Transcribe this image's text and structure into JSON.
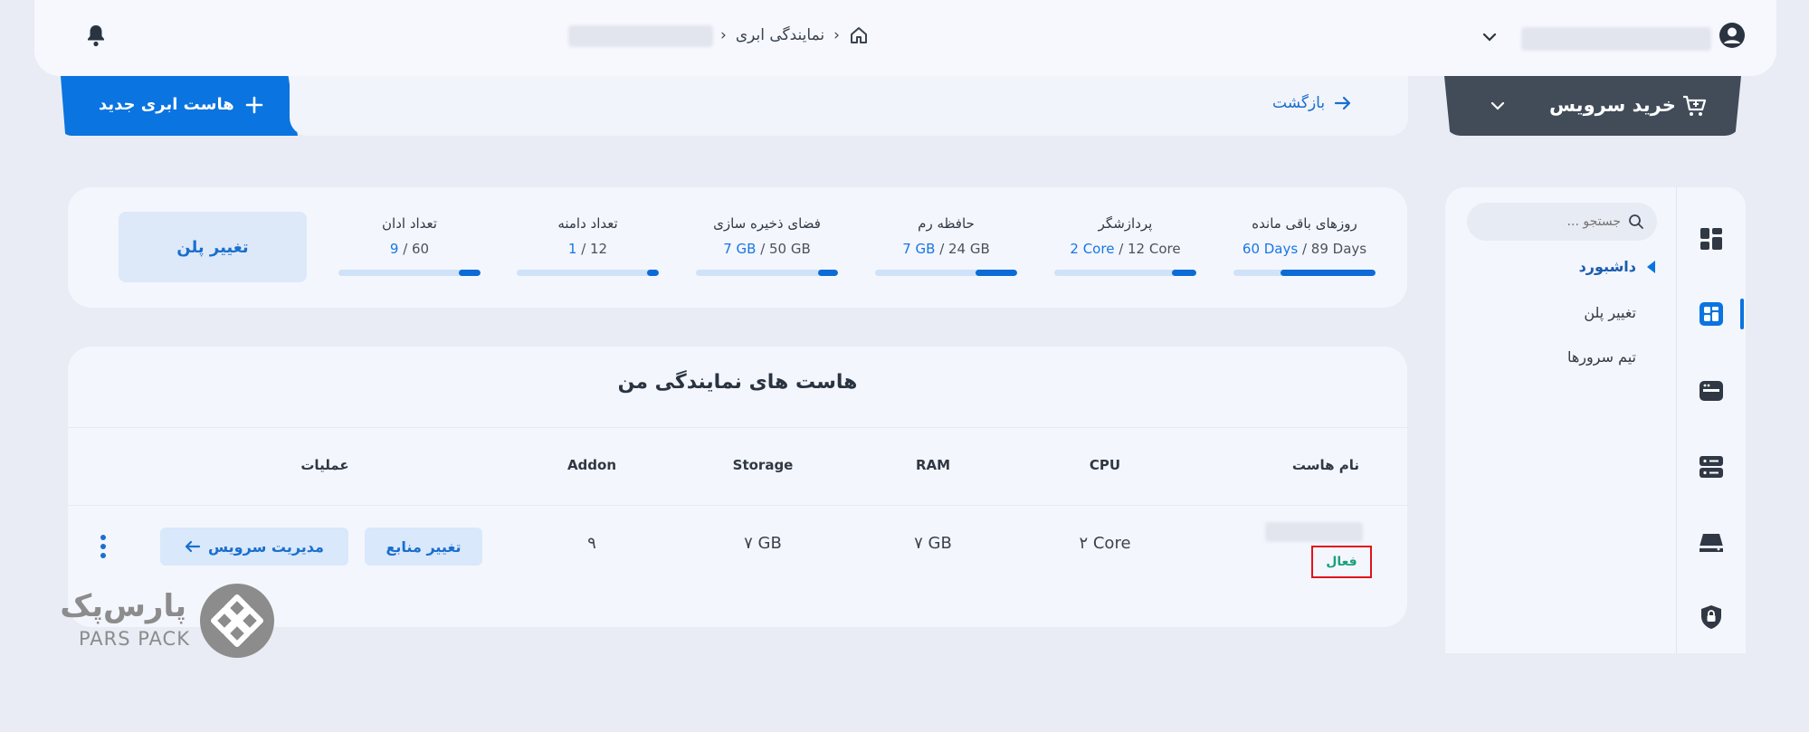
{
  "header": {
    "breadcrumb": {
      "home_icon": "home-icon",
      "item1": "نمایندگی ابری",
      "separator": "‹"
    },
    "notification_icon": "bell-icon",
    "account_chevron": "chevron-down-icon",
    "account_icon": "user-circle-icon"
  },
  "actions": {
    "buy_service": "خرید سرویس",
    "back": "بازگشت",
    "new_cloud_host": "هاست ابری جدید"
  },
  "stats": [
    {
      "label": "روزهای باقی مانده",
      "used": "60 Days",
      "total": "89 Days",
      "fill": 0.67
    },
    {
      "label": "پردازشگر",
      "used": "2 Core",
      "total": "12 Core",
      "fill": 0.17
    },
    {
      "label": "حافظه رم",
      "used": "7 GB",
      "total": "24 GB",
      "fill": 0.29
    },
    {
      "label": "فضای ذخیره سازی",
      "used": "7 GB",
      "total": "50 GB",
      "fill": 0.14
    },
    {
      "label": "تعداد دامنه",
      "used": "1",
      "total": "12",
      "fill": 0.08
    },
    {
      "label": "تعداد ادان",
      "used": "9",
      "total": "60",
      "fill": 0.15
    }
  ],
  "change_plan": "تغییر پلن",
  "table": {
    "title": "هاست های نمایندگی من",
    "columns": [
      "نام هاست",
      "CPU",
      "RAM",
      "Storage",
      "Addon",
      "عملیات"
    ],
    "row": {
      "status": "فعال",
      "cpu": "۲ Core",
      "ram": "۷ GB",
      "storage": "۷ GB",
      "addon": "۹",
      "change_resources": "تغییر منابع",
      "manage_service": "مدیریت سرویس"
    }
  },
  "sidebar": {
    "search_placeholder": "جستجو ...",
    "items": [
      "داشبورد",
      "تغییر پلن",
      "تیم سرورها"
    ]
  },
  "watermark": {
    "brand": "پارس‌پک",
    "brand_latin": "PARS PACK"
  },
  "colors": {
    "accent": "#0a74e0",
    "dark_button": "#414c58",
    "status_active": "#1aa07a",
    "highlight_box": "#e0141c"
  }
}
